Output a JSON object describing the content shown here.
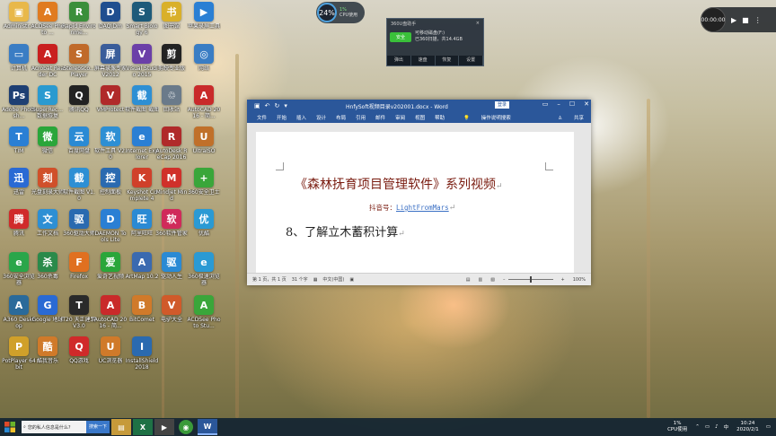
{
  "desktop_icons": [
    {
      "label": "Administr...",
      "color": "#e8b84a",
      "glyph": "▣"
    },
    {
      "label": "ACDSee Photo ...",
      "color": "#e07b20",
      "glyph": "A"
    },
    {
      "label": "Rapid Environme...",
      "color": "#3b8f3b",
      "glyph": "R"
    },
    {
      "label": "DAQ\\Dm",
      "color": "#1f4e8f",
      "glyph": "D"
    },
    {
      "label": "Smart Biology 6",
      "color": "#1d5a7a",
      "glyph": "S"
    },
    {
      "label": "图书馆",
      "color": "#d9b02a",
      "glyph": "书"
    },
    {
      "label": "苹果录屏工具",
      "color": "#2a7fd4",
      "glyph": "▶"
    },
    {
      "label": "计算机",
      "color": "#3a7dc4",
      "glyph": "▭"
    },
    {
      "label": "Acrobat Reader DC",
      "color": "#c91f1f",
      "glyph": "A"
    },
    {
      "label": "Stereosco... Player",
      "color": "#c06a2a",
      "glyph": "S"
    },
    {
      "label": "屏幕录像专家 V2012",
      "color": "#3a5d9a",
      "glyph": "屏"
    },
    {
      "label": "Visual Studio 2015",
      "color": "#6b3fa8",
      "glyph": "V"
    },
    {
      "label": "剪映专业版",
      "color": "#222222",
      "glyph": "剪"
    },
    {
      "label": "网络",
      "color": "#3a7dc4",
      "glyph": "◎"
    },
    {
      "label": "Adobe Photosh...",
      "color": "#1e3f73",
      "glyph": "Ps"
    },
    {
      "label": "SuperRec... 数据恢复",
      "color": "#2a9ad0",
      "glyph": "S"
    },
    {
      "label": "腾讯QQ",
      "color": "#222222",
      "glyph": "Q"
    },
    {
      "label": "VMProtect",
      "color": "#b02a2a",
      "glyph": "V"
    },
    {
      "label": "软件截图 截图",
      "color": "#2d8fd4",
      "glyph": "截"
    },
    {
      "label": "回收站",
      "color": "#6a7a8a",
      "glyph": "♲"
    },
    {
      "label": "AutoCAD 2016 - 简...",
      "color": "#c92a2a",
      "glyph": "A"
    },
    {
      "label": "TIM",
      "color": "#2a7fd4",
      "glyph": "T"
    },
    {
      "label": "微信",
      "color": "#2aa63a",
      "glyph": "微"
    },
    {
      "label": "百度网盘",
      "color": "#2a8ad4",
      "glyph": "云"
    },
    {
      "label": "软件工具 V2.0",
      "color": "#2d8fd4",
      "glyph": "软"
    },
    {
      "label": "Internet Explorer",
      "color": "#2a7fd4",
      "glyph": "e"
    },
    {
      "label": "AutoDesk ReCap 2016",
      "color": "#b02a2a",
      "glyph": "R"
    },
    {
      "label": "UltraISO",
      "color": "#c0702a",
      "glyph": "U"
    },
    {
      "label": "迅雷",
      "color": "#2a6ad4",
      "glyph": "迅"
    },
    {
      "label": "光盘刻录大师",
      "color": "#d0502a",
      "glyph": "刻"
    },
    {
      "label": "软件截图 V1.0",
      "color": "#2d8fd4",
      "glyph": "截"
    },
    {
      "label": "控制面板",
      "color": "#2a6ab0",
      "glyph": "控"
    },
    {
      "label": "Keyshot Complete 4",
      "color": "#d0402a",
      "glyph": "K"
    },
    {
      "label": "Mindjet Mind",
      "color": "#d0302a",
      "glyph": "M"
    },
    {
      "label": "360安全卫士",
      "color": "#3aa63a",
      "glyph": "+"
    },
    {
      "label": "腾讯",
      "color": "#d02a2a",
      "glyph": "腾"
    },
    {
      "label": "工作文档",
      "color": "#2d8fd4",
      "glyph": "文"
    },
    {
      "label": "360驱动大师",
      "color": "#2a6ab0",
      "glyph": "驱"
    },
    {
      "label": "DAEMON Tools Lite",
      "color": "#2a7fd4",
      "glyph": "D"
    },
    {
      "label": "阿里旺旺",
      "color": "#2a8ad4",
      "glyph": "旺"
    },
    {
      "label": "360软件管家",
      "color": "#d02a5a",
      "glyph": "软"
    },
    {
      "label": "优酷",
      "color": "#2a9ad4",
      "glyph": "优"
    },
    {
      "label": "360安全浏览器",
      "color": "#2aa64a",
      "glyph": "e"
    },
    {
      "label": "360杀毒",
      "color": "#2a8a4a",
      "glyph": "杀"
    },
    {
      "label": "Firefox",
      "color": "#e07020",
      "glyph": "F"
    },
    {
      "label": "爱奇艺视频",
      "color": "#2aa63a",
      "glyph": "爱"
    },
    {
      "label": "ArtMap 10.2",
      "color": "#3a6ab0",
      "glyph": "A"
    },
    {
      "label": "驱动人生",
      "color": "#2a8ad4",
      "glyph": "驱"
    },
    {
      "label": "360极速浏览器",
      "color": "#2a9ad4",
      "glyph": "e"
    },
    {
      "label": "A360 Desktop",
      "color": "#2a6a9a",
      "glyph": "A"
    },
    {
      "label": "Google 地球",
      "color": "#2a6ad4",
      "glyph": "G"
    },
    {
      "label": "T20 天正建筑 V3.0",
      "color": "#2a2a2a",
      "glyph": "T"
    },
    {
      "label": "AutoCAD 2016 - 简...",
      "color": "#c92a2a",
      "glyph": "A"
    },
    {
      "label": "BitComet",
      "color": "#d07a2a",
      "glyph": "B"
    },
    {
      "label": "电驴大全",
      "color": "#d05a2a",
      "glyph": "V"
    },
    {
      "label": "ACDSee Photo Stu...",
      "color": "#3aa63a",
      "glyph": "A"
    },
    {
      "label": "PotPlayer 64 bit",
      "color": "#d0a02a",
      "glyph": "P"
    },
    {
      "label": "酷我音乐",
      "color": "#d07a2a",
      "glyph": "酷"
    },
    {
      "label": "QQ游戏",
      "color": "#d02a2a",
      "glyph": "Q"
    },
    {
      "label": "UC浏览器",
      "color": "#d07a2a",
      "glyph": "U"
    },
    {
      "label": "InstallShield 2018",
      "color": "#2a6ab0",
      "glyph": "I"
    }
  ],
  "cpu_meter": {
    "value": "24%",
    "side_pct": "1%",
    "side_label": "CPU使用"
  },
  "usb_panel": {
    "title": "360U盘助手",
    "close": "×",
    "badge": "安全",
    "line1": "可移动磁盘(F:)",
    "line2": "已360扫描，共14.4GB",
    "footer": [
      "弹出",
      "速盘",
      "恢复",
      "设置"
    ]
  },
  "player": {
    "time": "00:00:00",
    "play": "▶",
    "stop": "■",
    "more": "⋮"
  },
  "word": {
    "doc_title": "HnfySoft视频目录v202001.docx - Word",
    "login": "登录",
    "tabs": [
      "文件",
      "开始",
      "插入",
      "设计",
      "布局",
      "引用",
      "邮件",
      "审阅",
      "视图",
      "帮助"
    ],
    "search": "操作说明搜索",
    "share": "共享",
    "heading": "《森林抚育项目管理软件》系列视频",
    "sub_prefix": "抖音号：",
    "sub_handle": "LightFromMars",
    "item": "8、了解立木蓄积计算",
    "para_mark": "↵",
    "status_page": "第 1 页，共 1 页",
    "status_words": "31 个字",
    "status_lang": "中文(中国)",
    "zoom": "100%"
  },
  "taskbar": {
    "search_text": "您的私人信息是什么?",
    "search_btn": "搜索一下",
    "tray_cpu": "1%",
    "tray_cpu_label": "CPU使用",
    "time": "10:24",
    "date": "2020/2/1"
  }
}
